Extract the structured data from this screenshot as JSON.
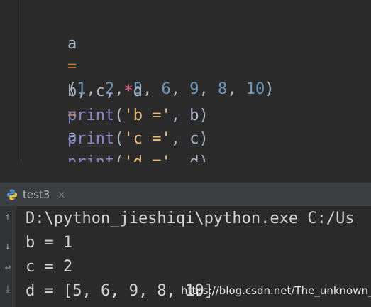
{
  "editor": {
    "line1": {
      "var": "a",
      "eq": "=",
      "nums": [
        "1",
        "2",
        "5",
        "6",
        "9",
        "8",
        "10"
      ]
    },
    "line2": {
      "b": "b",
      "c": "c",
      "star": "*",
      "d": "d",
      "eq": "=",
      "rhs": "a"
    },
    "prints": [
      {
        "fn": "print",
        "str": "'b ='",
        "arg": "b"
      },
      {
        "fn": "print",
        "str": "'c ='",
        "arg": "c"
      },
      {
        "fn": "print",
        "str": "'d ='",
        "arg": "d"
      }
    ]
  },
  "run_tab": {
    "label": "test3",
    "close": "×",
    "icon": "python-icon"
  },
  "console": {
    "lines": [
      "D:\\python_jieshiqi\\python.exe C:/Us",
      "b = 1",
      "c = 2",
      "d = [5, 6, 9, 8, 10]"
    ]
  },
  "watermark": "https://blog.csdn.net/The_unknown_",
  "colors": {
    "keyword": "#8888c6",
    "number": "#6897bb",
    "operator": "#cc7832",
    "string": "#e6c07b",
    "background": "#2b2b2b"
  }
}
